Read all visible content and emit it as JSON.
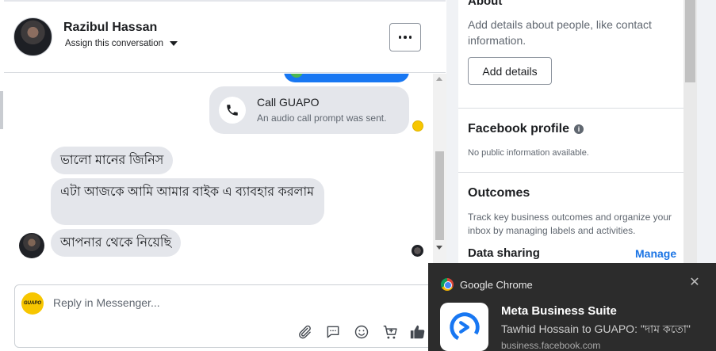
{
  "header": {
    "contact_name": "Razibul Hassan",
    "assign_label": "Assign this conversation"
  },
  "thread": {
    "call": {
      "title": "Call GUAPO",
      "subtitle": "An audio call prompt was sent."
    },
    "incoming_messages": [
      "ভালো মানের জিনিস",
      "এটা আজকে আমি আমার বাইক এ ব্যাবহার করলাম",
      "আপনার থেকে নিয়েছি"
    ]
  },
  "composer": {
    "placeholder": "Reply in Messenger...",
    "logo_text": "GUAPO"
  },
  "details": {
    "about": {
      "title": "About",
      "description": "Add details about people, like contact information.",
      "button_label": "Add details"
    },
    "facebook_profile": {
      "title": "Facebook profile",
      "subtitle": "No public information available."
    },
    "outcomes": {
      "title": "Outcomes",
      "description": "Track key business outcomes and organize your inbox by managing labels and activities."
    },
    "data_sharing": {
      "title": "Data sharing",
      "link_label": "Manage"
    }
  },
  "notification": {
    "app_name": "Google Chrome",
    "title": "Meta Business Suite",
    "body": "Tawhid Hossain to GUAPO: \"দাম কতো\"",
    "origin": "business.facebook.com",
    "close_glyph": "✕"
  },
  "colors": {
    "accent_blue": "#1877f2",
    "link_blue": "#1b74e4",
    "bubble_gray": "#e4e6eb",
    "toast_bg": "#2c2c2c",
    "brand_yellow": "#f7c600"
  }
}
